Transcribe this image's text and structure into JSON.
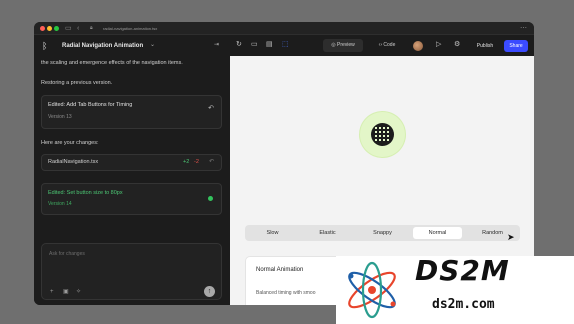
{
  "browser": {
    "url": "radial-navigation-animation.tsx",
    "menu_icon": "more-dots-icon"
  },
  "project": {
    "title": "Radial Navigation Animation"
  },
  "chat": {
    "intro_text": "the scaling and emergence effects of the navigation items.",
    "restoring_text": "Restoring a previous version.",
    "restored_version": {
      "title": "Edited: Add Tab Buttons for Timing",
      "version": "Version 13"
    },
    "changes_text": "Here are your changes:",
    "changed_file": {
      "name": "RadialNavigation.tsx",
      "additions": "+2",
      "deletions": "-2"
    },
    "current_version": {
      "title": "Edited: Set button size to 80px",
      "version": "Version 14"
    },
    "input_placeholder": "Ask for changes"
  },
  "toolbar": {
    "preview_label": "Preview",
    "code_label": "Code",
    "publish_label": "Publish",
    "share_label": "Share"
  },
  "preview": {
    "speed_options": [
      "Slow",
      "Elastic",
      "Snappy",
      "Normal",
      "Random"
    ],
    "selected_speed": "Normal",
    "card_title": "Normal Animation",
    "card_description": "Balanced timing with smoo"
  },
  "watermark": {
    "brand": "DS2M",
    "domain": "ds2m.com"
  },
  "colors": {
    "accent_blue": "#3b4bff",
    "success_green": "#4cc774",
    "diff_red": "#e5534b",
    "orb_green": "#e3f6c8"
  }
}
